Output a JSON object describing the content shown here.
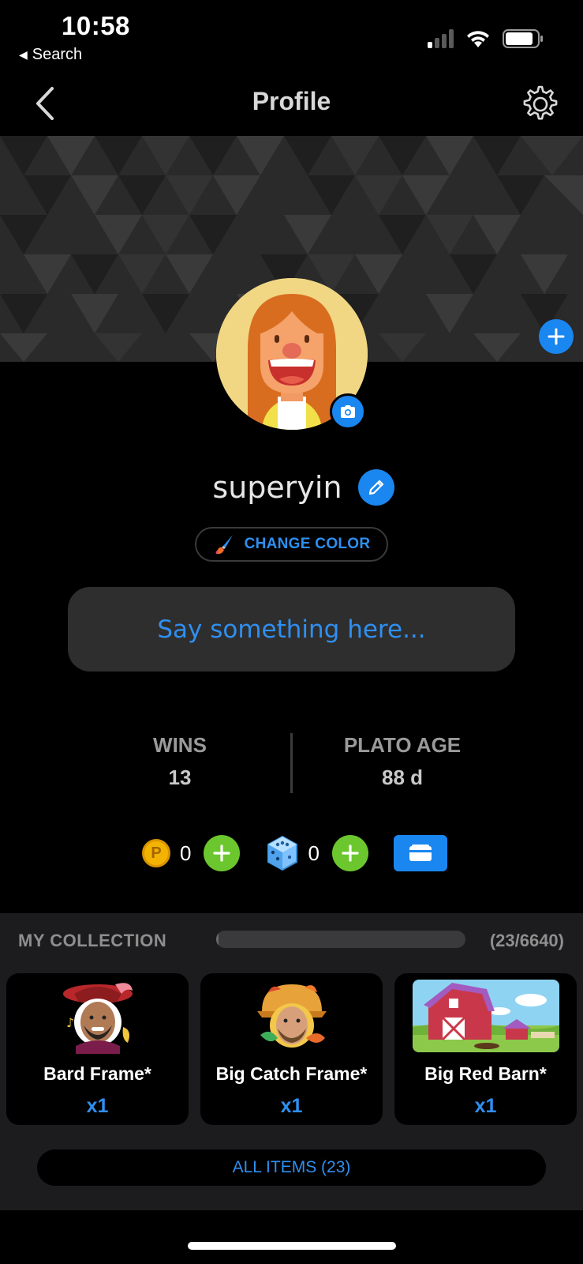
{
  "status_bar": {
    "time": "10:58",
    "back_app": "Search"
  },
  "nav": {
    "title": "Profile"
  },
  "profile": {
    "username": "superyin",
    "change_color_label": "CHANGE COLOR",
    "status_placeholder": "Say something here..."
  },
  "stats": [
    {
      "label": "WINS",
      "value": "13"
    },
    {
      "label": "PLATO AGE",
      "value": "88 d"
    }
  ],
  "currency": {
    "coins": "0",
    "gems": "0",
    "coin_symbol": "P"
  },
  "collection": {
    "title": "MY COLLECTION",
    "count": "(23/6640)",
    "progress_fraction": 0.0035,
    "items": [
      {
        "name": "Bard Frame*",
        "qty": "x1"
      },
      {
        "name": "Big Catch Frame*",
        "qty": "x1"
      },
      {
        "name": "Big Red Barn*",
        "qty": "x1"
      }
    ],
    "all_items_label": "ALL ITEMS (23)"
  },
  "colors": {
    "accent": "#1a86f0",
    "green": "#6cc72e",
    "coin": "#f4b300"
  }
}
